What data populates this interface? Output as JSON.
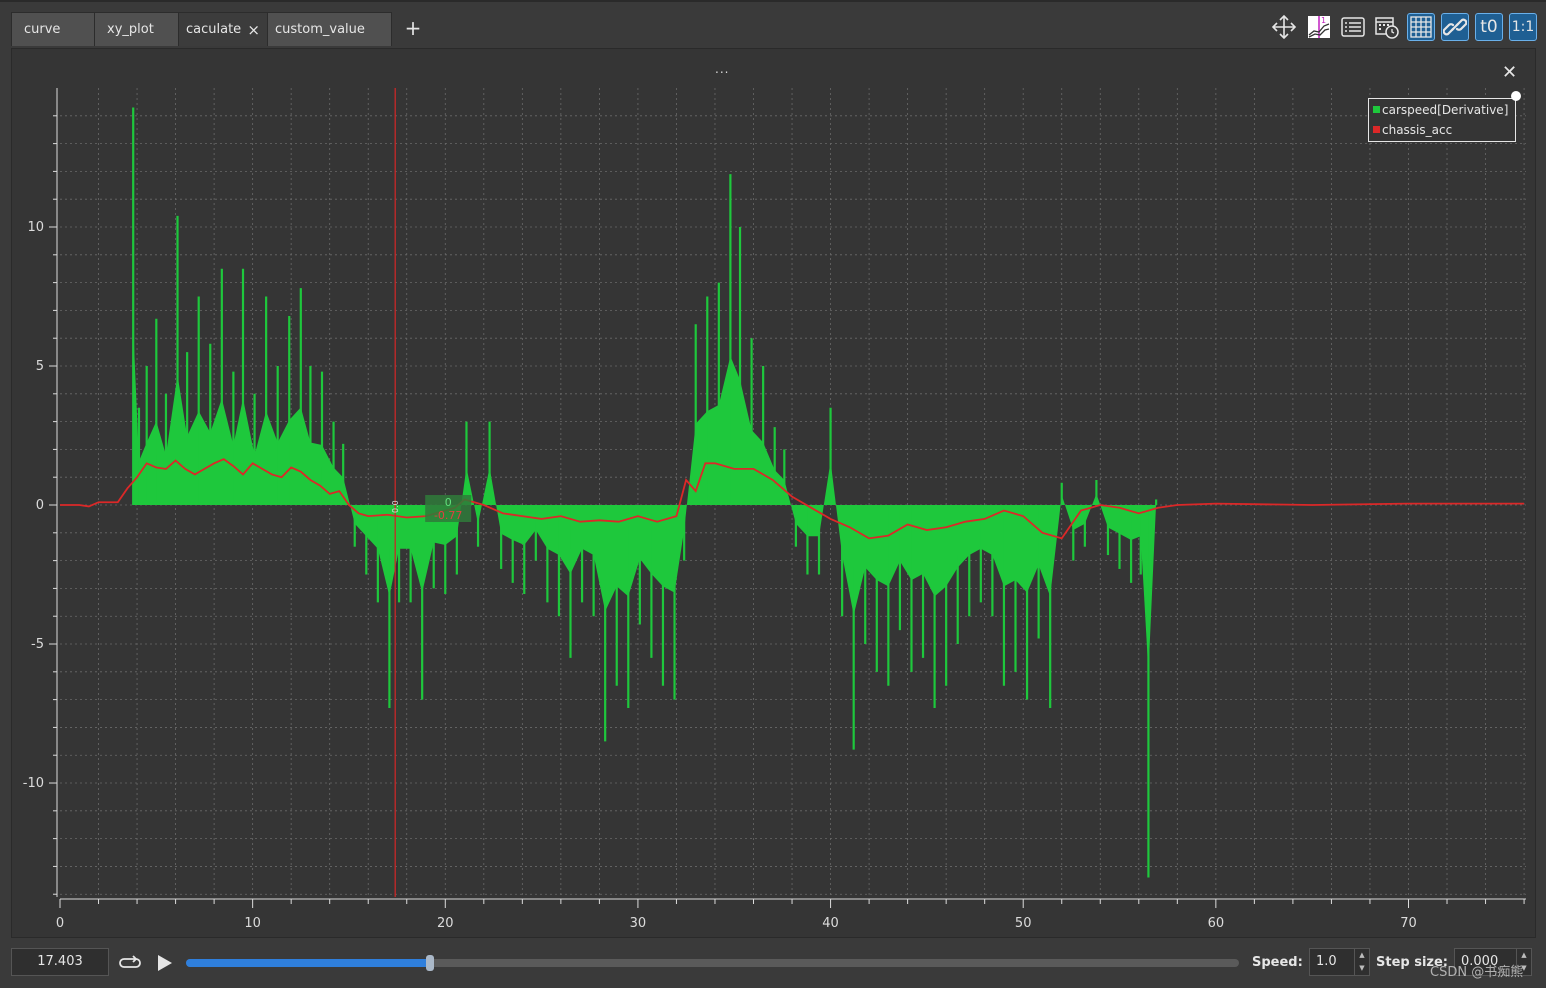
{
  "tabs": [
    {
      "label": "curve",
      "active": false
    },
    {
      "label": "xy_plot",
      "active": false
    },
    {
      "label": "caculate",
      "active": true,
      "close_icon": "×"
    },
    {
      "label": "custom_value",
      "active": false
    }
  ],
  "add_tab_icon": "+",
  "toolbar": {
    "buttons": [
      {
        "icon": "move-arrows-icon",
        "active": false
      },
      {
        "icon": "ruler-chart-icon",
        "active": false
      },
      {
        "icon": "list-legend-icon",
        "active": false
      },
      {
        "icon": "calendar-clock-icon",
        "active": false
      },
      {
        "icon": "grid-icon",
        "active": true
      },
      {
        "icon": "link-icon",
        "active": true
      },
      {
        "icon": "time-offset-icon",
        "label": "t0",
        "active": true
      },
      {
        "icon": "ratio-icon",
        "label": "1:1",
        "active": true
      }
    ]
  },
  "plot": {
    "dock_title": "...",
    "close_icon": "✕",
    "legend": [
      {
        "label": "carspeed[Derivative]",
        "color": "#1ec83c"
      },
      {
        "label": "chassis_acc",
        "color": "#dc2828"
      }
    ],
    "tracker": {
      "label_top": "0",
      "label_bottom": "-0.77",
      "side_value": "0.0"
    }
  },
  "chart_data": {
    "type": "line",
    "xlabel": "",
    "ylabel": "",
    "xlim": [
      0,
      76.1
    ],
    "ylim": [
      -14.1,
      15.0
    ],
    "x_ticks": [
      "0",
      "10",
      "20",
      "30",
      "40",
      "50",
      "60",
      "70"
    ],
    "y_ticks": [
      "10",
      "5",
      "0",
      "-5",
      "-10"
    ],
    "grid": true,
    "legend_position": "top-right",
    "cursor_x": 17.4,
    "series": [
      {
        "name": "carspeed[Derivative]",
        "color": "#1ec83c",
        "style": "sticks",
        "x": [
          3.8,
          4.1,
          4.5,
          5.0,
          5.5,
          6.1,
          6.6,
          7.2,
          7.8,
          8.4,
          9.0,
          9.5,
          10.1,
          10.7,
          11.3,
          11.9,
          12.5,
          13.0,
          13.6,
          14.2,
          14.7,
          15.3,
          15.9,
          16.5,
          17.1,
          17.6,
          18.2,
          18.8,
          19.4,
          20.0,
          20.6,
          21.1,
          21.7,
          22.3,
          22.9,
          23.5,
          24.1,
          24.7,
          25.3,
          25.9,
          26.5,
          27.1,
          27.7,
          28.3,
          28.9,
          29.5,
          30.1,
          30.7,
          31.3,
          31.9,
          32.4,
          33.0,
          33.6,
          34.2,
          34.8,
          35.3,
          35.9,
          36.5,
          37.1,
          37.6,
          38.2,
          38.8,
          39.4,
          40.0,
          40.6,
          41.2,
          41.8,
          42.4,
          43.0,
          43.6,
          44.2,
          44.8,
          45.4,
          46.0,
          46.6,
          47.2,
          47.8,
          48.4,
          49.0,
          49.6,
          50.2,
          50.8,
          51.4,
          52.0,
          52.6,
          53.2,
          53.8,
          54.4,
          55.0,
          55.6,
          56.1,
          56.5,
          56.9
        ],
        "y": [
          14.3,
          3.5,
          5.0,
          6.7,
          4.0,
          10.4,
          5.5,
          7.5,
          5.8,
          8.5,
          4.8,
          8.5,
          4.0,
          7.5,
          5.0,
          6.8,
          7.8,
          5.0,
          4.8,
          3.0,
          2.2,
          -1.5,
          -2.5,
          -3.5,
          -7.3,
          -3.5,
          -3.5,
          -7.0,
          -3.0,
          -3.2,
          -2.5,
          3.0,
          -1.5,
          3.0,
          -2.3,
          -2.8,
          -3.2,
          -2.0,
          -3.5,
          -4.0,
          -5.5,
          -3.5,
          -4.0,
          -8.5,
          -6.5,
          -7.3,
          -4.3,
          -5.5,
          -6.5,
          -7.0,
          -2.0,
          6.5,
          7.5,
          8.0,
          11.9,
          10.0,
          6.0,
          5.0,
          2.8,
          2.0,
          -1.5,
          -2.5,
          -2.5,
          3.5,
          -4.0,
          -8.8,
          -5.0,
          -6.0,
          -6.5,
          -4.5,
          -6.0,
          -5.5,
          -7.3,
          -6.5,
          -5.0,
          -4.0,
          -3.5,
          -4.0,
          -6.5,
          -6.0,
          -7.0,
          -4.8,
          -7.3,
          0.8,
          -2.0,
          -1.5,
          0.9,
          -1.8,
          -2.3,
          -2.8,
          -2.5,
          -13.4,
          0.2
        ]
      },
      {
        "name": "chassis_acc",
        "color": "#dc2828",
        "style": "line",
        "x": [
          0,
          1.0,
          1.5,
          2.0,
          3.0,
          3.5,
          4.0,
          4.5,
          5.0,
          5.5,
          6.0,
          6.5,
          7.0,
          7.5,
          8.0,
          8.5,
          9.0,
          9.5,
          10.0,
          10.5,
          11.0,
          11.5,
          12.0,
          12.5,
          13.0,
          13.5,
          14.0,
          14.5,
          15.0,
          15.5,
          16.0,
          17.0,
          18.0,
          19.0,
          20.0,
          20.5,
          21.0,
          22.0,
          23.0,
          24.0,
          25.0,
          26.0,
          27.0,
          28.0,
          29.0,
          30.0,
          31.0,
          32.0,
          32.5,
          33.0,
          33.5,
          34.0,
          35.0,
          36.0,
          37.0,
          38.0,
          39.0,
          40.0,
          41.0,
          42.0,
          43.0,
          44.0,
          45.0,
          46.0,
          47.0,
          48.0,
          49.0,
          50.0,
          51.0,
          52.0,
          53.0,
          54.0,
          55.0,
          56.0,
          57.0,
          58.0,
          60.0,
          65.0,
          70.0,
          76.0
        ],
        "y": [
          0.0,
          0.0,
          -0.05,
          0.1,
          0.1,
          0.6,
          1.0,
          1.5,
          1.35,
          1.3,
          1.6,
          1.3,
          1.1,
          1.3,
          1.5,
          1.65,
          1.4,
          1.1,
          1.5,
          1.3,
          1.1,
          1.0,
          1.35,
          1.2,
          0.9,
          0.7,
          0.4,
          0.5,
          0.0,
          -0.3,
          -0.4,
          -0.35,
          -0.45,
          -0.4,
          -0.2,
          -0.1,
          0.2,
          0.0,
          -0.3,
          -0.4,
          -0.5,
          -0.4,
          -0.6,
          -0.55,
          -0.6,
          -0.4,
          -0.6,
          -0.4,
          0.9,
          0.5,
          1.5,
          1.5,
          1.3,
          1.3,
          0.9,
          0.3,
          -0.1,
          -0.5,
          -0.8,
          -1.2,
          -1.1,
          -0.7,
          -0.9,
          -0.8,
          -0.6,
          -0.5,
          -0.2,
          -0.4,
          -1.0,
          -1.2,
          -0.2,
          0.0,
          -0.1,
          -0.3,
          -0.1,
          0.0,
          0.05,
          0.0,
          0.05,
          0.05
        ]
      }
    ]
  },
  "bottom_bar": {
    "time_value": "17.403",
    "progress": 0.232,
    "speed_label": "Speed:",
    "speed_value": "1.0",
    "step_label": "Step size:",
    "step_value": "0.000",
    "watermark": "CSDN @书痴熊"
  }
}
